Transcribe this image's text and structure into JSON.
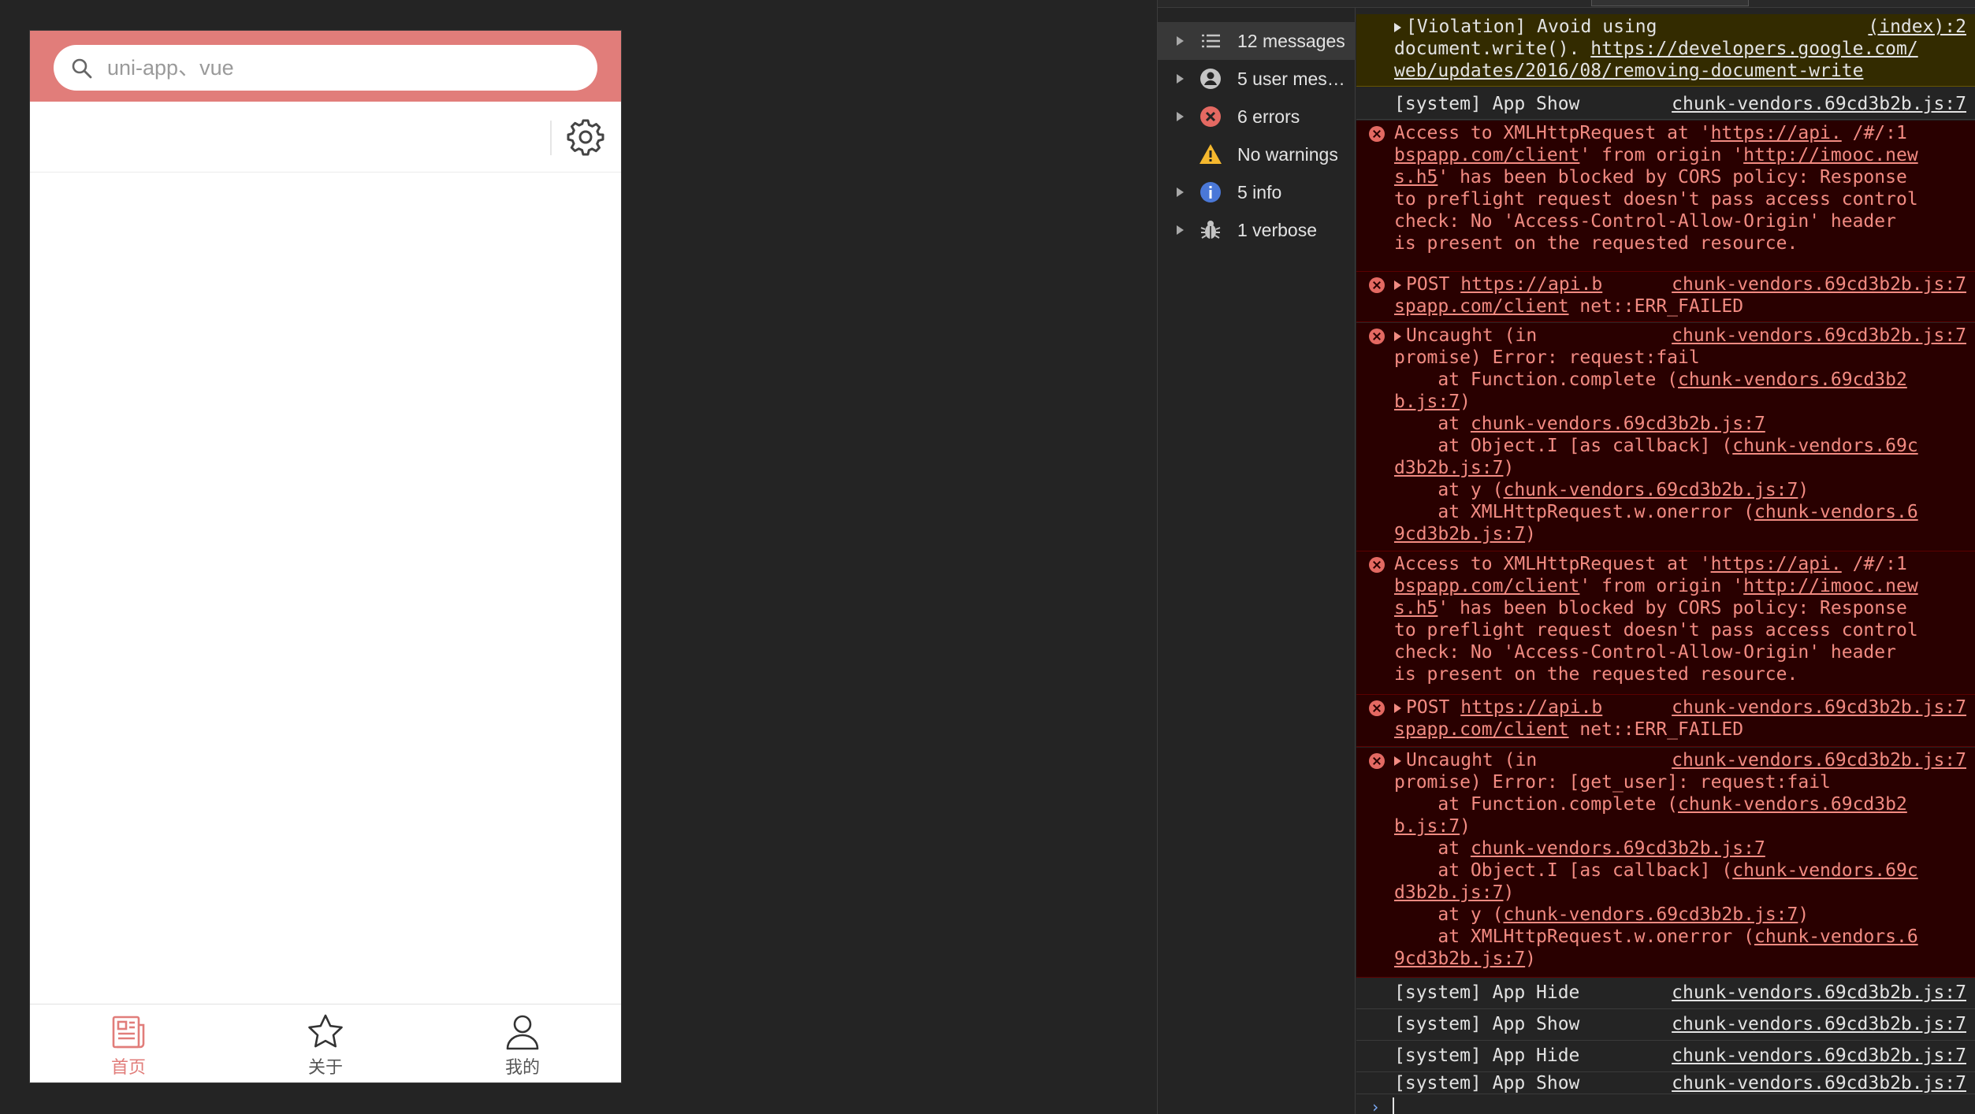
{
  "phone": {
    "search_placeholder": "uni-app、vue",
    "tabbar": [
      {
        "label": "首页",
        "icon": "news-icon",
        "active": true
      },
      {
        "label": "关于",
        "icon": "star-icon",
        "active": false
      },
      {
        "label": "我的",
        "icon": "user-icon",
        "active": false
      }
    ],
    "accent_color": "#e17d7a"
  },
  "devtools": {
    "sidebar": [
      {
        "label": "12 messages",
        "icon": "list-icon",
        "expandable": true
      },
      {
        "label": "5 user mes…",
        "icon": "user-circle-icon",
        "expandable": true
      },
      {
        "label": "6 errors",
        "icon": "error-icon",
        "expandable": true
      },
      {
        "label": "No warnings",
        "icon": "warning-icon",
        "expandable": false
      },
      {
        "label": "5 info",
        "icon": "info-icon",
        "expandable": true
      },
      {
        "label": "1 verbose",
        "icon": "bug-icon",
        "expandable": true
      }
    ],
    "messages": {
      "m0_l1": "[Violation] Avoid using",
      "m0_src": "(index):2",
      "m0_l2a": "document.write(). ",
      "m0_l2b": "https://developers.google.com/",
      "m0_l3": "web/updates/2016/08/removing-document-write",
      "m1_text": "[system] App Show",
      "src": "chunk-vendors.69cd3b2b.js:7",
      "cors_l1a": "Access to XMLHttpRequest at '",
      "cors_l1b": "https://api.",
      "cors_l1c": " /#/:1",
      "cors_l2a": "bspapp.com/client",
      "cors_l2b": "' from origin '",
      "cors_l2c": "http://imooc.new",
      "cors_l3a": "s.h5",
      "cors_l3b": "' has been blocked by CORS policy: Response",
      "cors_l4": "to preflight request doesn't pass access control",
      "cors_l5": "check: No 'Access-Control-Allow-Origin' header",
      "cors_l6": "is present on the requested resource.",
      "post_l1a": "POST ",
      "post_l1b": "https://api.b",
      "post_l2a": "spapp.com/client",
      "post_l2b": " net::ERR_FAILED",
      "unc_l1": "Uncaught (in",
      "unc1_l2": "promise) Error: request:fail",
      "unc2_l2": "promise) Error: [get_user]: request:fail",
      "st_l1a": "    at Function.complete (",
      "st_l1b": "chunk-vendors.69cd3b2",
      "st_l2": "b.js:7",
      "st_l3a": "    at ",
      "st_l3b": "chunk-vendors.69cd3b2b.js:7",
      "st_l4a": "    at Object.I [as callback] (",
      "st_l4b": "chunk-vendors.69c",
      "st_l5": "d3b2b.js:7",
      "st_l6a": "    at y (",
      "st_l6b": "chunk-vendors.69cd3b2b.js:7",
      "st_l7a": "    at XMLHttpRequest.w.onerror (",
      "st_l7b": "chunk-vendors.6",
      "st_l8": "9cd3b2b.js:7",
      "hide": "[system] App Hide",
      "show": "[system] App Show"
    },
    "colors": {
      "error_bg": "#290000",
      "error_text": "#f28b82",
      "violation_bg": "#332b00"
    }
  }
}
